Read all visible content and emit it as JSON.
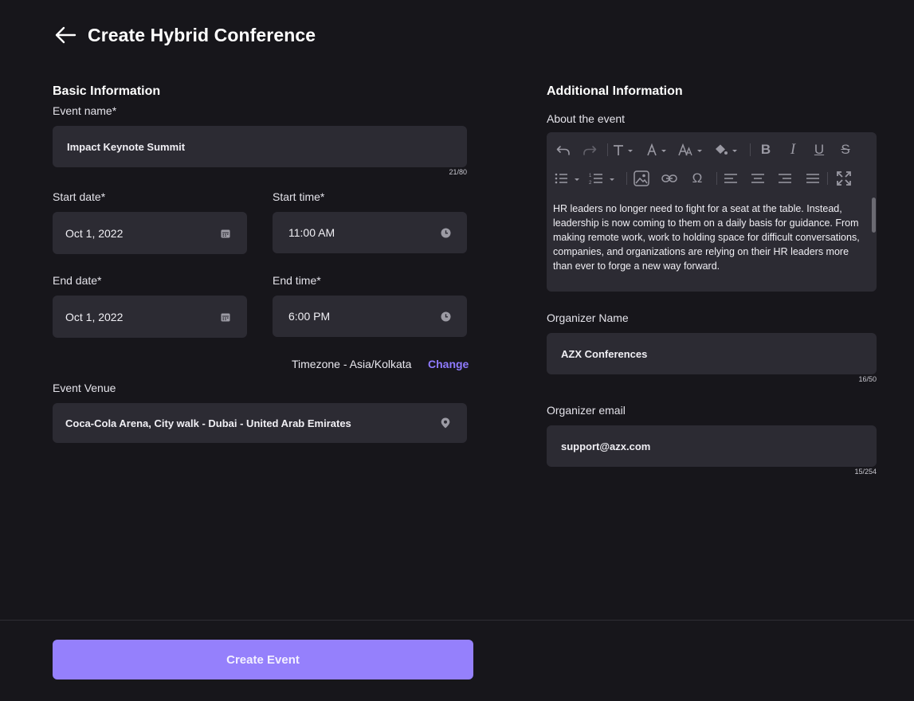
{
  "header": {
    "title": "Create Hybrid Conference",
    "back_icon": "arrow-left-icon"
  },
  "basic": {
    "title": "Basic Information",
    "event_name": {
      "label": "Event name*",
      "value": "Impact Keynote Summit",
      "counter": "21/80"
    },
    "start_date": {
      "label": "Start date*",
      "value": "Oct 1, 2022",
      "icon": "calendar-icon"
    },
    "start_time": {
      "label": "Start time*",
      "value": "11:00 AM",
      "icon": "clock-icon"
    },
    "end_date": {
      "label": "End date*",
      "value": "Oct 1, 2022",
      "icon": "calendar-icon"
    },
    "end_time": {
      "label": "End time*",
      "value": "6:00 PM",
      "icon": "clock-icon"
    },
    "timezone": {
      "text": "Timezone - Asia/Kolkata",
      "change_label": "Change"
    },
    "venue": {
      "label": "Event Venue",
      "value": "Coca-Cola Arena, City walk - Dubai - United Arab Emirates",
      "icon": "location-pin-icon"
    }
  },
  "additional": {
    "title": "Additional Information",
    "about": {
      "label": "About the event",
      "text": "HR leaders no longer need to fight for a seat at the table. Instead, leadership is now coming to them on a daily basis for guidance. From making remote work, work to holding space for difficult conversations, companies, and organizations are relying on their HR leaders more than ever to forge a new way forward."
    },
    "organizer_name": {
      "label": "Organizer Name",
      "value": "AZX Conferences",
      "counter": "16/50"
    },
    "organizer_email": {
      "label": "Organizer email",
      "value": "support@azx.com",
      "counter": "15/254"
    }
  },
  "footer": {
    "create_label": "Create Event"
  },
  "colors": {
    "background": "#17161b",
    "field": "#2c2b33",
    "accent": "#9580fc",
    "link": "#8f7bff"
  }
}
